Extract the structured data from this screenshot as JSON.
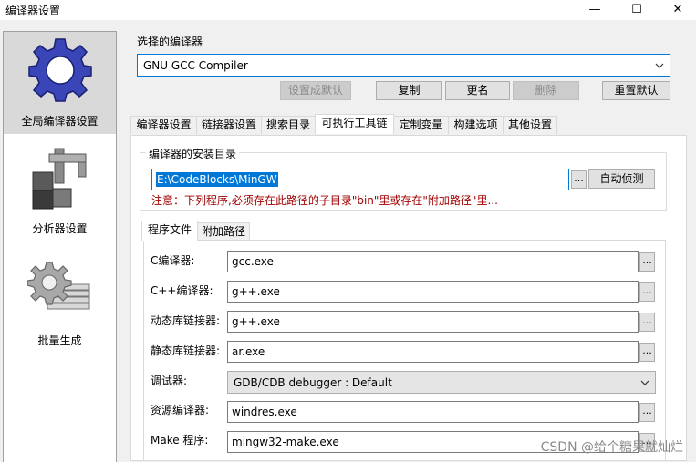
{
  "window": {
    "title": "编译器设置",
    "minimize": "—",
    "maximize": "☐",
    "close": "✕"
  },
  "sidebar": {
    "items": [
      {
        "label": "全局编译器设置",
        "icon": "gear-icon",
        "selected": true
      },
      {
        "label": "分析器设置",
        "icon": "caliper-blocks-icon",
        "selected": false
      },
      {
        "label": "批量生成",
        "icon": "gear-stack-icon",
        "selected": false
      }
    ]
  },
  "compiler": {
    "section_label": "选择的编译器",
    "selected": "GNU GCC Compiler"
  },
  "buttons": {
    "set_default": "设置成默认",
    "copy": "复制",
    "rename": "更名",
    "delete": "删除",
    "reset_defaults": "重置默认"
  },
  "tabs": [
    "编译器设置",
    "链接器设置",
    "搜索目录",
    "可执行工具链",
    "定制变量",
    "构建选项",
    "其他设置"
  ],
  "active_tab": "可执行工具链",
  "install_dir": {
    "group_label": "编译器的安装目录",
    "value": "E:\\CodeBlocks\\MinGW",
    "browse": "...",
    "auto_detect": "自动侦测",
    "warning": "注意：下列程序,必须存在此路径的子目录\"bin\"里或存在\"附加路径\"里..."
  },
  "subtabs": [
    "程序文件",
    "附加路径"
  ],
  "active_subtab": "程序文件",
  "programs": [
    {
      "label": "C编译器:",
      "value": "gcc.exe",
      "type": "text"
    },
    {
      "label": "C++编译器:",
      "value": "g++.exe",
      "type": "text"
    },
    {
      "label": "动态库链接器:",
      "value": "g++.exe",
      "type": "text"
    },
    {
      "label": "静态库链接器:",
      "value": "ar.exe",
      "type": "text"
    },
    {
      "label": "调试器:",
      "value": "GDB/CDB debugger : Default",
      "type": "select"
    },
    {
      "label": "资源编译器:",
      "value": "windres.exe",
      "type": "text"
    },
    {
      "label": "Make 程序:",
      "value": "mingw32-make.exe",
      "type": "text"
    }
  ],
  "browse_label": "...",
  "watermark": "CSDN @给个糖果就灿烂",
  "colors": {
    "accent": "#0078d7",
    "warning": "#a00000",
    "gear": "#3a46b8"
  }
}
